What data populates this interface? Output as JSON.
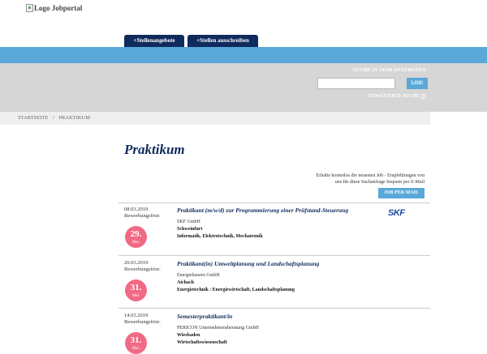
{
  "header": {
    "logo_alt": "Logo Jobportal",
    "tabs": [
      {
        "label": "+Stellenangebote"
      },
      {
        "label": "+Stellen ausschreiben"
      }
    ]
  },
  "search": {
    "count_label": "SUCHE IN 20148 ANGEBOTEN",
    "input_value": "",
    "button_label": "LOS!",
    "advanced_label": "ERWEITERTE SUCHE"
  },
  "breadcrumb": {
    "home": "STARTSEITE",
    "separator": "/",
    "current": "PRAKTIKUM"
  },
  "page": {
    "title": "Praktikum"
  },
  "alert": {
    "line1": "Erhalte kostenlos die neuesten Job - Empfehlungen von",
    "line2": "uns für diese Suchanfrage bequem per E-Mail",
    "button_label": "JOB PER MAIL"
  },
  "jobs": [
    {
      "date": "08.03.2019",
      "deadline_label": "Bewerbungsfrist:",
      "deadline_day": "29.",
      "deadline_month": "Mar.",
      "title": "Praktikant (m/w/d) zur Programmierung einer Prüfstand-Steuerung",
      "company": "SKF GmbH",
      "city": "Schweinfurt",
      "categories": "Informatik, Elektrotechnik, Mechatronik",
      "company_logo_text": "SKF"
    },
    {
      "date": "20.03.2019",
      "deadline_label": "Bewerbungsfrist:",
      "deadline_day": "31.",
      "deadline_month": "Mar.",
      "title": "Praktikant(in) Umweltplanung und Landschaftsplanung",
      "company": "Energiebauern GmbH",
      "city": "Aichach",
      "categories": "Energietechnik / Energiewirtschaft, Landschaftsplanung"
    },
    {
      "date": "14.03.2019",
      "deadline_label": "Bewerbungsfrist:",
      "deadline_day": "31.",
      "deadline_month": "Mar.",
      "title": "Semesterpraktikant/in",
      "company": "PERICON Unternehmensberatung GmbH",
      "city": "Wiesbaden",
      "categories": "Wirtschaftswissenschaft"
    }
  ],
  "colors": {
    "navy": "#0f2a5c",
    "accent_blue": "#5aa8d8",
    "badge_pink": "#f06a85",
    "search_gray": "#d6d6d6"
  }
}
